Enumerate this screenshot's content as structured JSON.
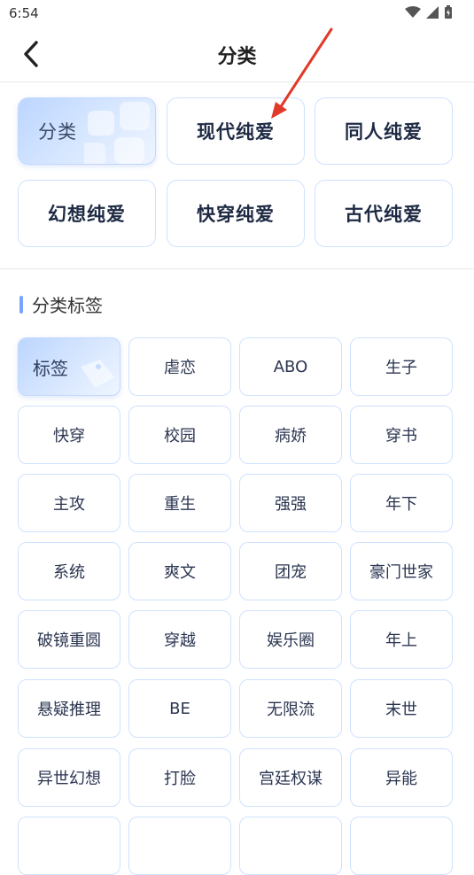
{
  "status_bar": {
    "time": "6:54"
  },
  "header": {
    "title": "分类"
  },
  "categories": [
    {
      "label": "分类",
      "active": true
    },
    {
      "label": "现代纯爱"
    },
    {
      "label": "同人纯爱"
    },
    {
      "label": "幻想纯爱"
    },
    {
      "label": "快穿纯爱"
    },
    {
      "label": "古代纯爱"
    }
  ],
  "tags_section": {
    "title": "分类标签"
  },
  "tags": [
    "标签",
    "虐恋",
    "ABO",
    "生子",
    "快穿",
    "校园",
    "病娇",
    "穿书",
    "主攻",
    "重生",
    "强强",
    "年下",
    "系统",
    "爽文",
    "团宠",
    "豪门世家",
    "破镜重圆",
    "穿越",
    "娱乐圈",
    "年上",
    "悬疑推理",
    "BE",
    "无限流",
    "末世",
    "异世幻想",
    "打脸",
    "宫廷权谋",
    "异能"
  ],
  "colors": {
    "accent": "#7aa3ff",
    "card_border": "#cfe2ff",
    "annotation_arrow": "#e03a2a"
  }
}
